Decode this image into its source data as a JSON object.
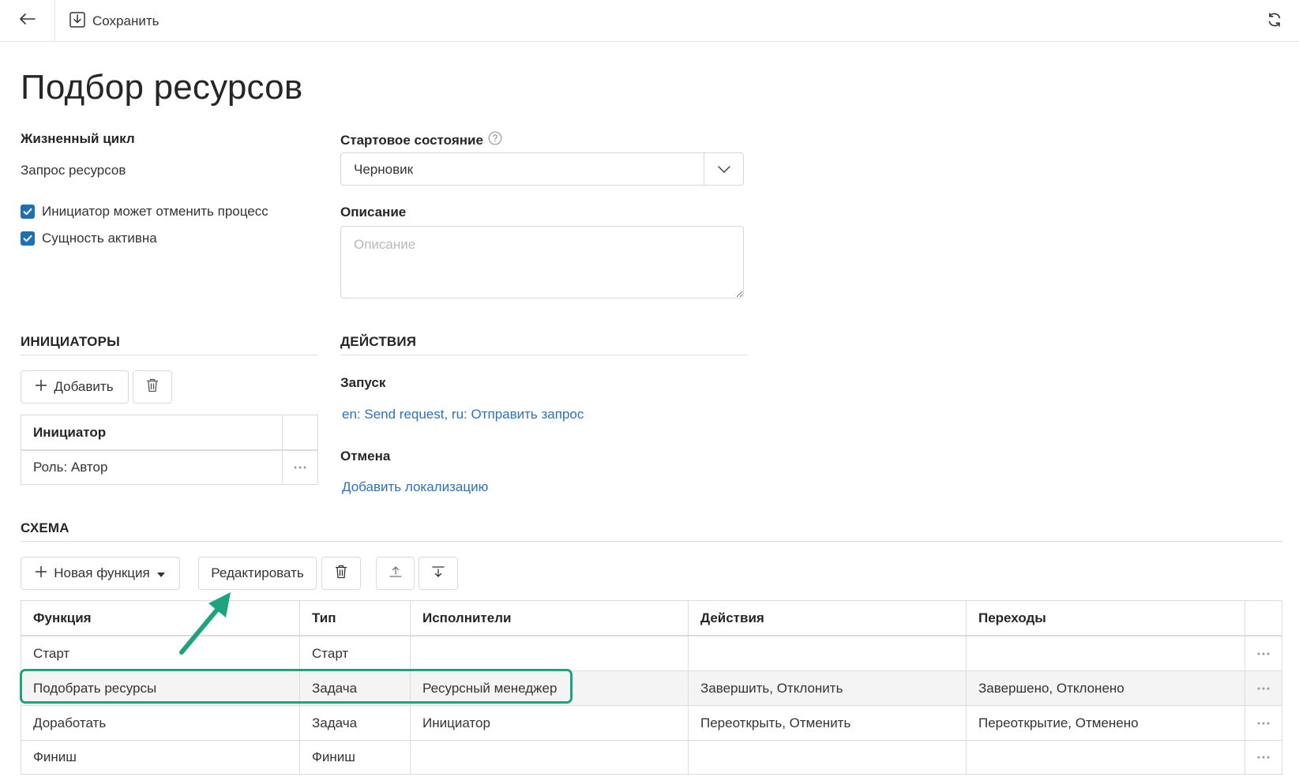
{
  "toolbar": {
    "save_label": "Сохранить",
    "back_icon": "arrow-left-icon",
    "save_icon": "save-icon",
    "refresh_icon": "refresh-icon"
  },
  "page": {
    "title": "Подбор ресурсов"
  },
  "lifecycle": {
    "label": "Жизненный цикл",
    "value": "Запрос ресурсов"
  },
  "checkboxes": [
    {
      "label": "Инициатор может отменить процесс",
      "checked": true
    },
    {
      "label": "Сущность активна",
      "checked": true
    }
  ],
  "start_state": {
    "label": "Стартовое состояние",
    "value": "Черновик",
    "help_icon": "help-circle-icon"
  },
  "description": {
    "label": "Описание",
    "placeholder": "Описание",
    "value": ""
  },
  "initiators": {
    "title": "ИНИЦИАТОРЫ",
    "add_label": "Добавить",
    "table_header": "Инициатор",
    "rows": [
      "Роль: Автор"
    ]
  },
  "actions": {
    "title": "ДЕЙСТВИЯ",
    "launch_label": "Запуск",
    "launch_value": "en: Send request, ru: Отправить запрос",
    "cancel_label": "Отмена",
    "cancel_value": "Добавить локализацию"
  },
  "schema": {
    "title": "СХЕМА",
    "new_function_label": "Новая функция",
    "edit_label": "Редактировать",
    "columns": [
      "Функция",
      "Тип",
      "Исполнители",
      "Действия",
      "Переходы"
    ],
    "rows": [
      [
        "Старт",
        "Старт",
        "",
        "",
        ""
      ],
      [
        "Подобрать ресурсы",
        "Задача",
        "Ресурсный менеджер",
        "Завершить, Отклонить",
        "Завершено, Отклонено"
      ],
      [
        "Доработать",
        "Задача",
        "Инициатор",
        "Переоткрыть, Отменить",
        "Переоткрытие, Отменено"
      ],
      [
        "Финиш",
        "Финиш",
        "",
        "",
        ""
      ]
    ],
    "highlighted_row": 1
  },
  "colors": {
    "accent": "#1f6fb5",
    "link": "#2d72b8",
    "annotation": "#1fa37f"
  }
}
